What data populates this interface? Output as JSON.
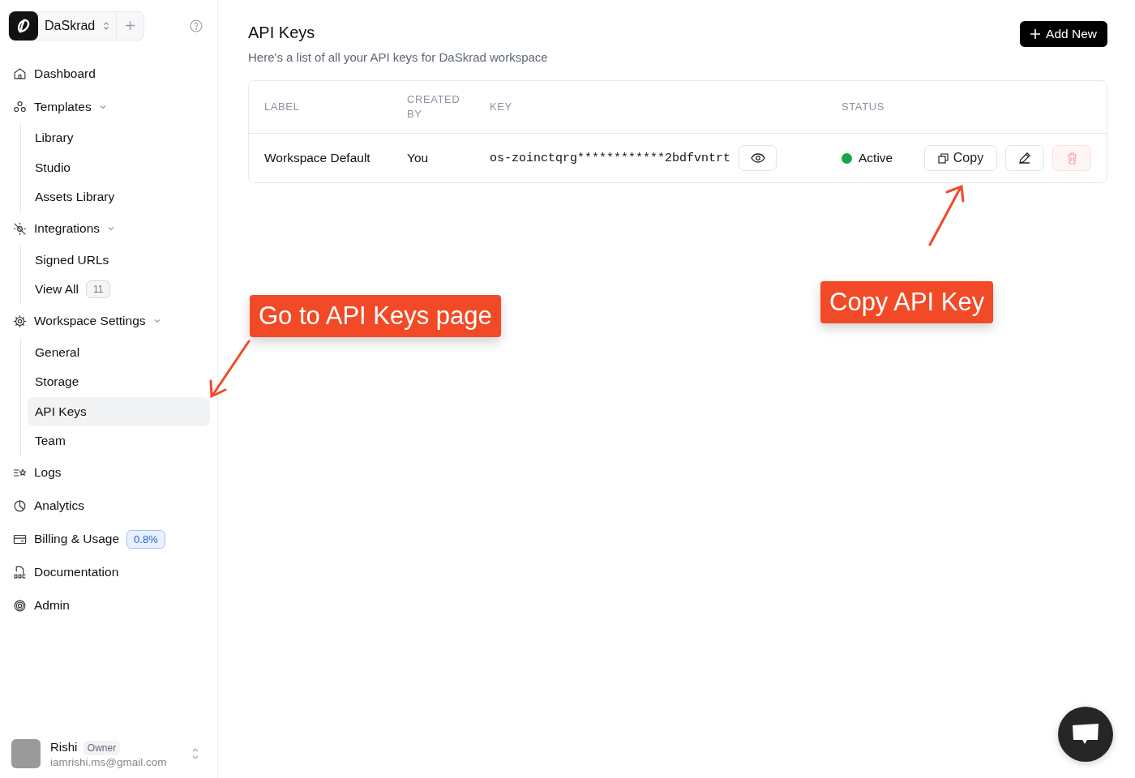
{
  "workspace": {
    "name": "DaSkrad"
  },
  "nav": [
    {
      "label": "Dashboard",
      "selected": false
    },
    {
      "label": "Templates",
      "expanded": true,
      "selected": false,
      "children": [
        {
          "label": "Library",
          "selected": false
        },
        {
          "label": "Studio",
          "selected": false
        },
        {
          "label": "Assets Library",
          "selected": false
        }
      ]
    },
    {
      "label": "Integrations",
      "expanded": true,
      "selected": false,
      "children": [
        {
          "label": "Signed URLs",
          "selected": false
        },
        {
          "label": "View All",
          "badge": "11",
          "selected": false
        }
      ]
    },
    {
      "label": "Workspace Settings",
      "expanded": true,
      "selected": false,
      "children": [
        {
          "label": "General",
          "selected": false
        },
        {
          "label": "Storage",
          "selected": false
        },
        {
          "label": "API Keys",
          "selected": true
        },
        {
          "label": "Team",
          "selected": false
        }
      ]
    },
    {
      "label": "Logs",
      "selected": false
    },
    {
      "label": "Analytics",
      "selected": false
    },
    {
      "label": "Billing & Usage",
      "badge": "0.8%",
      "selected": false
    },
    {
      "label": "Documentation",
      "selected": false
    },
    {
      "label": "Admin",
      "selected": false
    }
  ],
  "user": {
    "name": "Rishi",
    "role": "Owner",
    "email": "iamrishi.ms@gmail.com"
  },
  "page": {
    "title": "API Keys",
    "subtitle": "Here's a list of all your API keys for DaSkrad workspace",
    "add_button": "Add New"
  },
  "table": {
    "columns": [
      "LABEL",
      "CREATED BY",
      "KEY",
      "STATUS"
    ],
    "rows": [
      {
        "label": "Workspace Default",
        "created_by": "You",
        "key": "os-zoinctqrg************2bdfvntrt",
        "status": "Active",
        "color": "#16a34a",
        "copy": "Copy"
      }
    ]
  },
  "annotations": [
    {
      "text": "Go to API Keys page"
    },
    {
      "text": "Copy API Key"
    }
  ]
}
